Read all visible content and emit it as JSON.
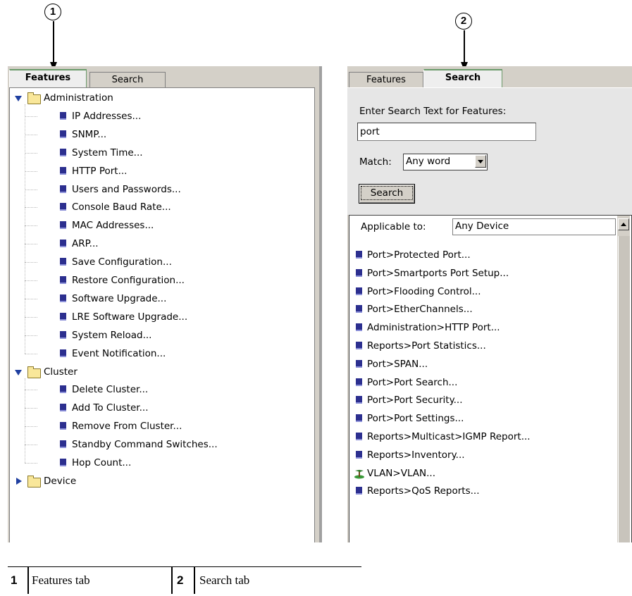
{
  "callouts": [
    {
      "label": "1"
    },
    {
      "label": "2"
    }
  ],
  "left_panel": {
    "tabs": [
      "Features",
      "Search"
    ],
    "tree": [
      {
        "type": "folder",
        "label": "Administration",
        "expanded": true
      },
      {
        "type": "item",
        "label": "IP Addresses..."
      },
      {
        "type": "item",
        "label": "SNMP..."
      },
      {
        "type": "item",
        "label": "System Time..."
      },
      {
        "type": "item",
        "label": "HTTP Port..."
      },
      {
        "type": "item",
        "label": "Users and Passwords..."
      },
      {
        "type": "item",
        "label": "Console Baud Rate..."
      },
      {
        "type": "item",
        "label": "MAC Addresses..."
      },
      {
        "type": "item",
        "label": "ARP..."
      },
      {
        "type": "item",
        "label": "Save Configuration..."
      },
      {
        "type": "item",
        "label": "Restore Configuration..."
      },
      {
        "type": "item",
        "label": "Software Upgrade..."
      },
      {
        "type": "item",
        "label": "LRE Software Upgrade..."
      },
      {
        "type": "item",
        "label": "System Reload..."
      },
      {
        "type": "item",
        "label": "Event Notification..."
      },
      {
        "type": "folder",
        "label": "Cluster",
        "expanded": true
      },
      {
        "type": "item",
        "label": "Delete Cluster..."
      },
      {
        "type": "item",
        "label": "Add To Cluster..."
      },
      {
        "type": "item",
        "label": "Remove From Cluster..."
      },
      {
        "type": "item",
        "label": "Standby Command Switches..."
      },
      {
        "type": "item",
        "label": "Hop Count..."
      },
      {
        "type": "folder",
        "label": "Device",
        "expanded": false
      }
    ]
  },
  "right_panel": {
    "tabs": [
      "Features",
      "Search"
    ],
    "search_label": "Enter Search Text for Features:",
    "search_value": "port",
    "match_label": "Match:",
    "match_value": "Any word",
    "search_button": "Search",
    "applicable_label": "Applicable to:",
    "applicable_value": "Any Device",
    "results": [
      {
        "label": "Port>Protected Port...",
        "icon": "feature-icon"
      },
      {
        "label": "Port>Smartports Port Setup...",
        "icon": "feature-icon"
      },
      {
        "label": "Port>Flooding Control...",
        "icon": "feature-icon"
      },
      {
        "label": "Port>EtherChannels...",
        "icon": "feature-icon"
      },
      {
        "label": "Administration>HTTP Port...",
        "icon": "feature-icon"
      },
      {
        "label": "Reports>Port Statistics...",
        "icon": "feature-icon"
      },
      {
        "label": "Port>SPAN...",
        "icon": "feature-icon"
      },
      {
        "label": "Port>Port Search...",
        "icon": "feature-icon"
      },
      {
        "label": "Port>Port Security...",
        "icon": "feature-icon"
      },
      {
        "label": "Port>Port Settings...",
        "icon": "feature-icon"
      },
      {
        "label": "Reports>Multicast>IGMP Report...",
        "icon": "feature-icon"
      },
      {
        "label": "Reports>Inventory...",
        "icon": "feature-icon"
      },
      {
        "label": "VLAN>VLAN...",
        "icon": "vlan-icon"
      },
      {
        "label": "Reports>QoS Reports...",
        "icon": "feature-icon"
      }
    ]
  },
  "legend": [
    {
      "num": "1",
      "text": "Features tab"
    },
    {
      "num": "2",
      "text": "Search tab"
    }
  ]
}
